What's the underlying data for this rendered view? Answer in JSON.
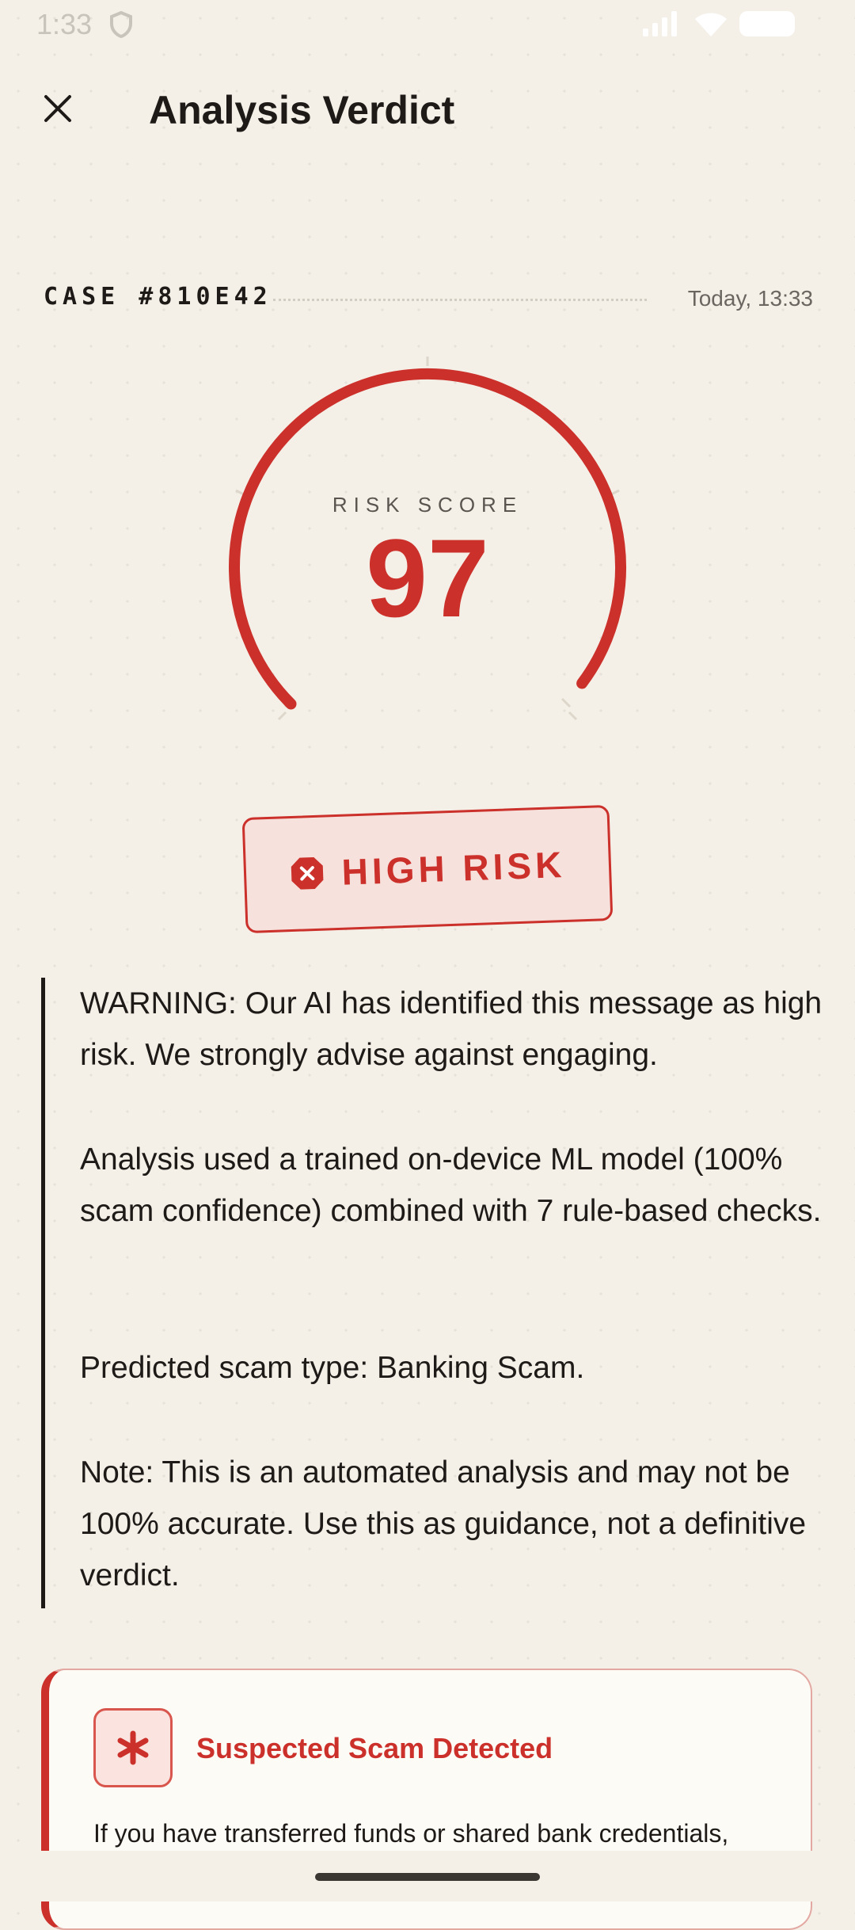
{
  "status_bar": {
    "time": "1:33"
  },
  "app_bar": {
    "title": "Analysis Verdict",
    "close_icon": "close-icon"
  },
  "case": {
    "id": "CASE #810E42",
    "timestamp": "Today, 13:33"
  },
  "risk": {
    "label": "RISK SCORE",
    "score": "97",
    "score_value": 97,
    "score_max": 100,
    "badge": "HIGH RISK",
    "color": "#cc302b"
  },
  "analysis": {
    "warning": "WARNING: Our AI has identified this message as high risk. We strongly advise against engaging.",
    "method": "Analysis used a trained on-device ML model (100% scam confidence) combined with 7 rule-based checks.",
    "scam_type": "Predicted scam type: Banking Scam.",
    "note": "Note: This is an automated analysis and may not be 100% accurate. Use this as guidance, not a definitive verdict."
  },
  "alert_card": {
    "title": "Suspected Scam Detected",
    "body": "If you have transferred funds or shared bank credentials,",
    "icon": "asterisk-icon"
  }
}
